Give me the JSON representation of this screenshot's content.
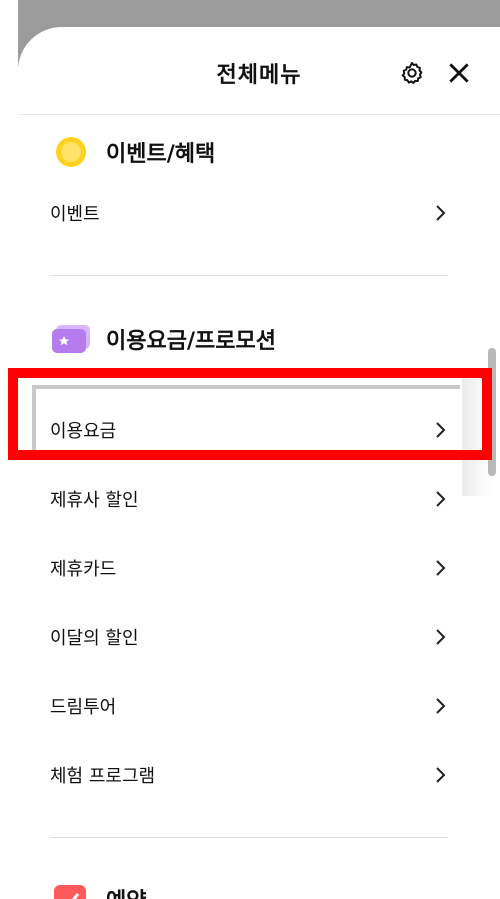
{
  "header": {
    "title": "전체메뉴",
    "settings_icon": "gear-icon",
    "close_icon": "close-icon"
  },
  "sections": [
    {
      "title": "이벤트/혜택",
      "icon": "coin-icon",
      "items": [
        {
          "label": "이벤트"
        }
      ]
    },
    {
      "title": "이용요금/프로모션",
      "icon": "ticket-icon",
      "items": [
        {
          "label": "이용요금"
        },
        {
          "label": "제휴사 할인"
        },
        {
          "label": "제휴카드"
        },
        {
          "label": "이달의 할인"
        },
        {
          "label": "드림투어"
        },
        {
          "label": "체험 프로그램"
        }
      ]
    },
    {
      "title": "예약",
      "icon": "calendar-check-icon",
      "items": []
    }
  ],
  "colors": {
    "highlight": "#ff0000",
    "coin": "#ffd21f",
    "ticket": "#b57cf0",
    "calendar": "#ff5a5a"
  }
}
